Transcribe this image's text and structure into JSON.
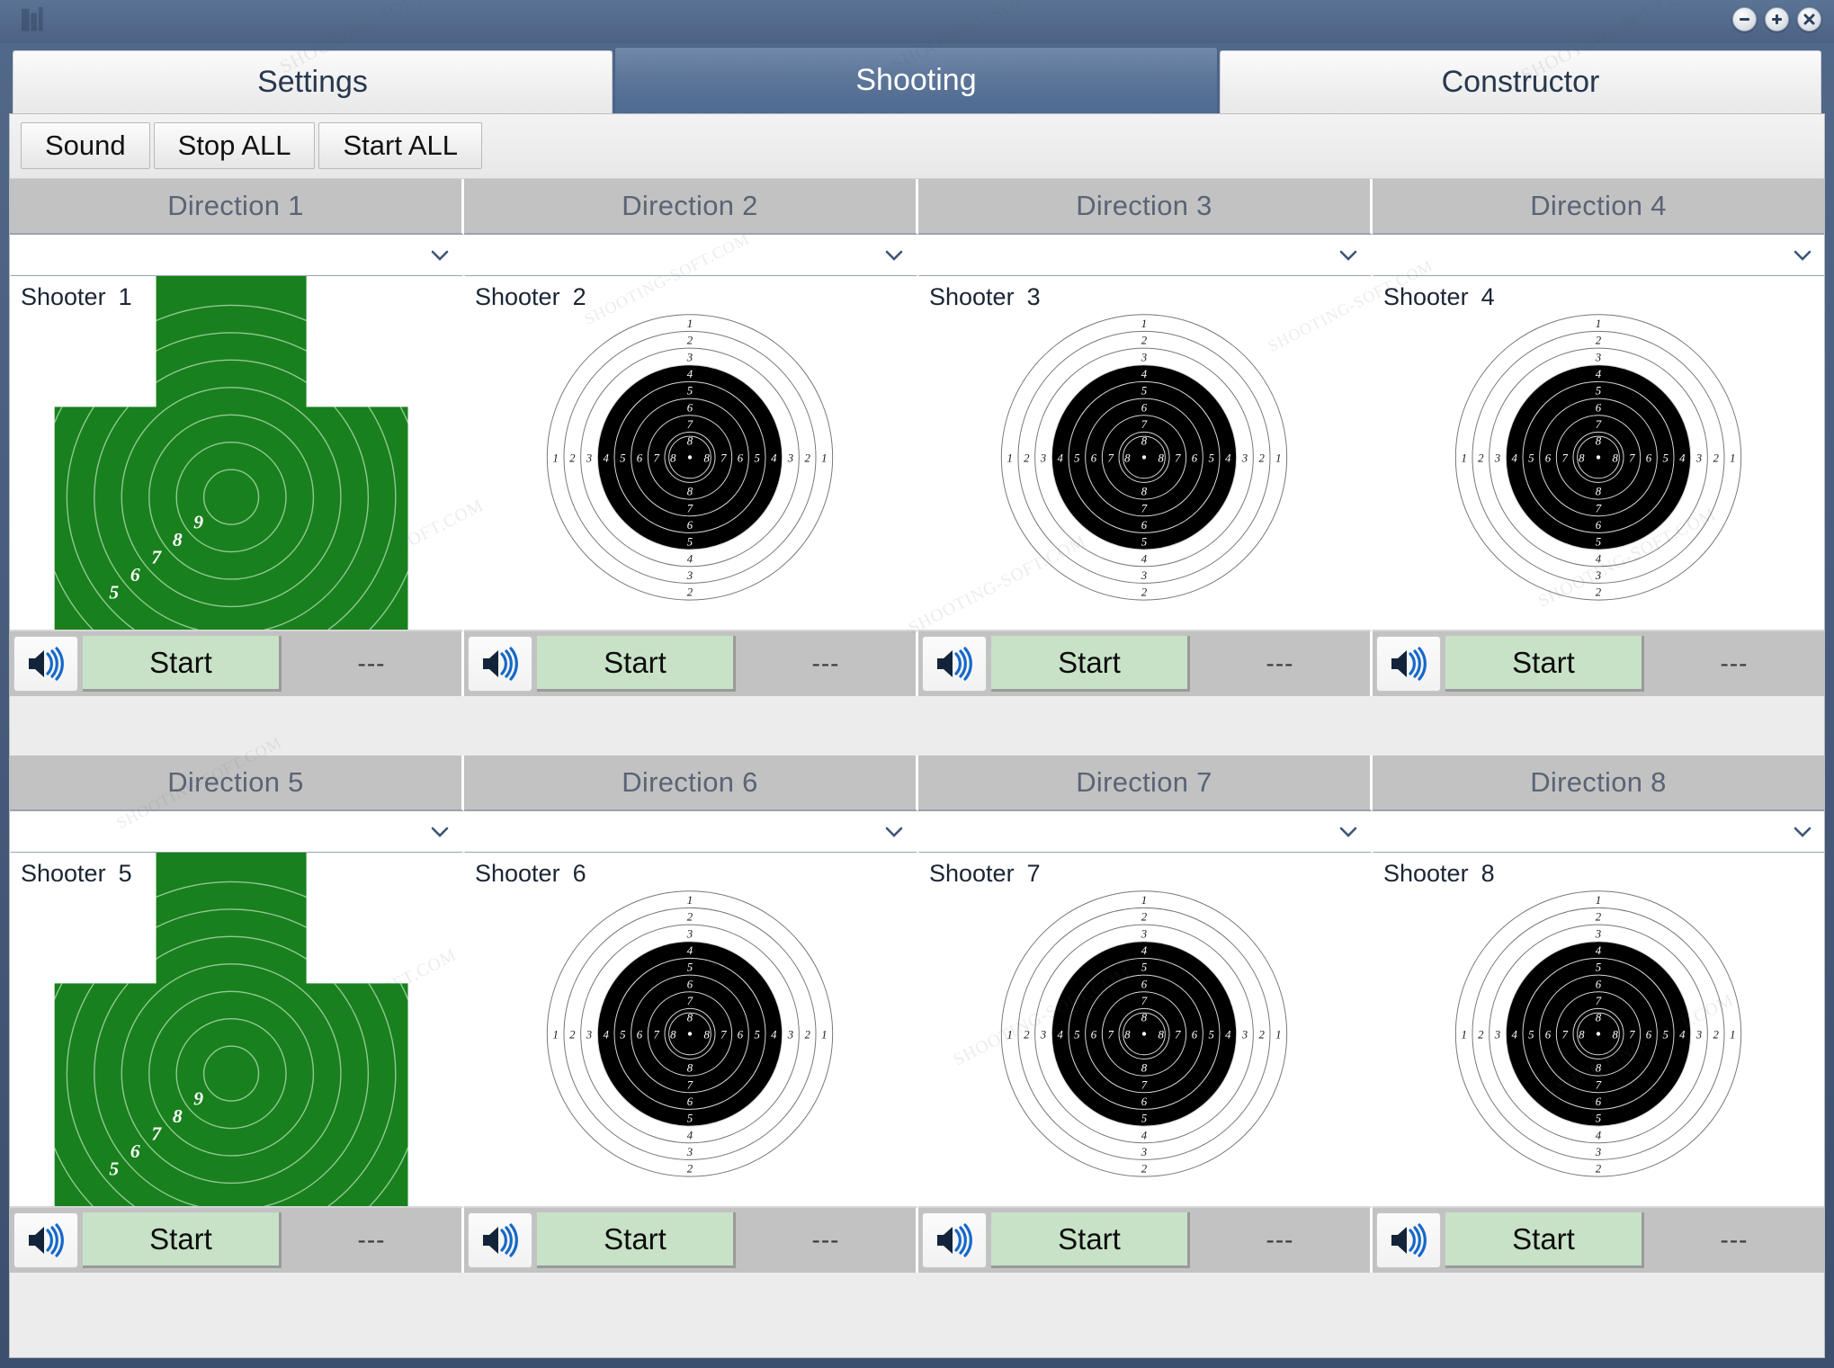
{
  "window": {
    "controls": [
      {
        "name": "minimize",
        "glyph": "minus"
      },
      {
        "name": "maximize",
        "glyph": "plus"
      },
      {
        "name": "close",
        "glyph": "cross"
      }
    ]
  },
  "tabs": [
    {
      "id": "settings",
      "label": "Settings",
      "active": false
    },
    {
      "id": "shooting",
      "label": "Shooting",
      "active": true
    },
    {
      "id": "constructor",
      "label": "Constructor",
      "active": false
    }
  ],
  "toolbar": {
    "sound_label": "Sound",
    "stop_all_label": "Stop ALL",
    "start_all_label": "Start ALL"
  },
  "watermark_text": "SHOOTING-SOFT.COM",
  "colors": {
    "title_bar": "#4c6284",
    "active_tab": "#5d7699",
    "inactive_tab": "#f0f0f0",
    "direction_header": "#c2c2c2",
    "start_button": "#c8e2c8",
    "status_box": "#c2c2c2",
    "green_target": "#19801e",
    "black_target": "#000000",
    "speaker_wave": "#1668c8"
  },
  "target_rings": {
    "vertical_top": [
      "1",
      "2",
      "3",
      "4",
      "5",
      "6",
      "7",
      "8"
    ],
    "vertical_bottom": [
      "8",
      "7",
      "6",
      "5",
      "4",
      "3",
      "2"
    ],
    "horizontal_left": [
      "1",
      "2",
      "3",
      "4",
      "5",
      "6",
      "7",
      "8"
    ],
    "horizontal_right": [
      "8",
      "7",
      "6",
      "5",
      "4",
      "3",
      "2",
      "1"
    ],
    "green_scores": [
      "9",
      "8",
      "7",
      "6",
      "5"
    ]
  },
  "lanes": [
    {
      "direction": "Direction 1",
      "shooter_label": "Shooter",
      "shooter_num": "1",
      "selection": "",
      "target_type": "silhouette-green",
      "start_label": "Start",
      "status": "---",
      "sound_icon": "speaker-icon"
    },
    {
      "direction": "Direction 2",
      "shooter_label": "Shooter",
      "shooter_num": "2",
      "selection": "",
      "target_type": "circular-black",
      "start_label": "Start",
      "status": "---",
      "sound_icon": "speaker-icon"
    },
    {
      "direction": "Direction 3",
      "shooter_label": "Shooter",
      "shooter_num": "3",
      "selection": "",
      "target_type": "circular-black",
      "start_label": "Start",
      "status": "---",
      "sound_icon": "speaker-icon"
    },
    {
      "direction": "Direction 4",
      "shooter_label": "Shooter",
      "shooter_num": "4",
      "selection": "",
      "target_type": "circular-black",
      "start_label": "Start",
      "status": "---",
      "sound_icon": "speaker-icon"
    },
    {
      "direction": "Direction 5",
      "shooter_label": "Shooter",
      "shooter_num": "5",
      "selection": "",
      "target_type": "silhouette-green",
      "start_label": "Start",
      "status": "---",
      "sound_icon": "speaker-icon"
    },
    {
      "direction": "Direction 6",
      "shooter_label": "Shooter",
      "shooter_num": "6",
      "selection": "",
      "target_type": "circular-black",
      "start_label": "Start",
      "status": "---",
      "sound_icon": "speaker-icon"
    },
    {
      "direction": "Direction 7",
      "shooter_label": "Shooter",
      "shooter_num": "7",
      "selection": "",
      "target_type": "circular-black",
      "start_label": "Start",
      "status": "---",
      "sound_icon": "speaker-icon"
    },
    {
      "direction": "Direction 8",
      "shooter_label": "Shooter",
      "shooter_num": "8",
      "selection": "",
      "target_type": "circular-black",
      "start_label": "Start",
      "status": "---",
      "sound_icon": "speaker-icon"
    }
  ]
}
